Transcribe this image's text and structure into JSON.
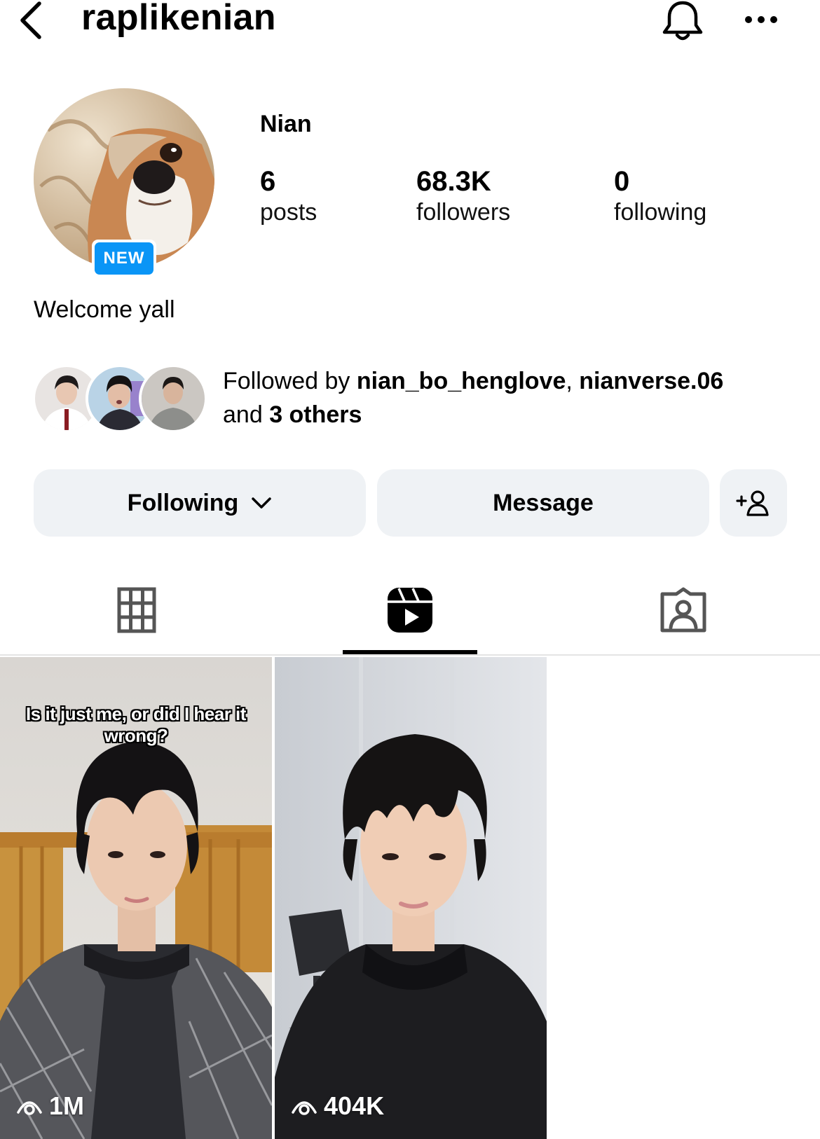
{
  "header": {
    "username": "raplikenian",
    "back_icon": "chevron-left-icon",
    "bell_icon": "bell-icon",
    "more_icon": "more-horizontal-icon"
  },
  "profile": {
    "display_name": "Nian",
    "new_badge": "NEW",
    "bio": "Welcome yall",
    "stats": {
      "posts": {
        "value": "6",
        "label": "posts"
      },
      "followers": {
        "value": "68.3K",
        "label": "followers"
      },
      "following": {
        "value": "0",
        "label": "following"
      }
    }
  },
  "followed_by": {
    "prefix": "Followed by ",
    "user1": "nian_bo_henglove",
    "separator": ", ",
    "user2": "nianverse.06",
    "and": "and ",
    "others": "3 others"
  },
  "actions": {
    "following_label": "Following",
    "message_label": "Message",
    "add_user_icon": "add-user-icon"
  },
  "tabs": [
    {
      "name": "grid",
      "icon": "grid-icon",
      "active": false
    },
    {
      "name": "reels",
      "icon": "reels-icon",
      "active": true
    },
    {
      "name": "tagged",
      "icon": "tagged-icon",
      "active": false
    }
  ],
  "reels": [
    {
      "caption": "Is it just me, or did I hear it wrong?",
      "views": "1M"
    },
    {
      "caption": "",
      "views": "404K"
    }
  ],
  "colors": {
    "badge_blue": "#0a95f6",
    "button_bg": "#eff2f5"
  }
}
